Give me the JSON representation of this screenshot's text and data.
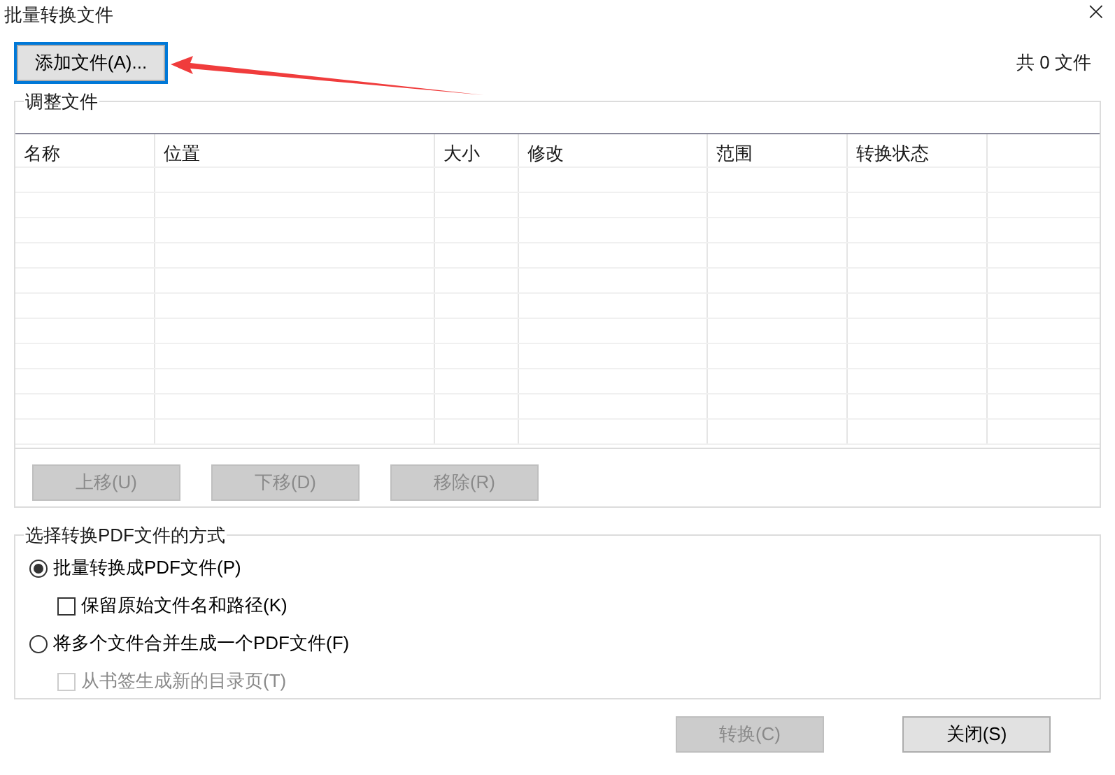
{
  "window": {
    "title": "批量转换文件",
    "close": "×"
  },
  "add_button": {
    "label": "添加文件(A)...",
    "focused": true
  },
  "file_count": "共 0 文件",
  "adjust_group": {
    "title": "调整文件",
    "table": {
      "columns": [
        "名称",
        "位置",
        "大小",
        "修改",
        "范围",
        "转换状态"
      ]
    },
    "buttons": [
      {
        "label": "上移(U)",
        "disabled": true
      },
      {
        "label": "下移(D)",
        "disabled": true
      },
      {
        "label": "移除(R)",
        "disabled": true
      }
    ]
  },
  "mode_group": {
    "title": "选择转换PDF文件的方式",
    "options": [
      {
        "kind": "radio",
        "label": "批量转换成PDF文件(P)",
        "selected": true,
        "disabled": false
      },
      {
        "kind": "checkbox",
        "label": "保留原始文件名和路径(K)",
        "checked": false,
        "disabled": false
      },
      {
        "kind": "radio",
        "label": "将多个文件合并生成一个PDF文件(F)",
        "selected": false,
        "disabled": false
      },
      {
        "kind": "checkbox",
        "label": "从书签生成新的目录页(T)",
        "checked": false,
        "disabled": true
      }
    ]
  },
  "footer_buttons": [
    {
      "label": "转换(C)",
      "disabled": true
    },
    {
      "label": "关闭(S)",
      "disabled": false
    }
  ]
}
